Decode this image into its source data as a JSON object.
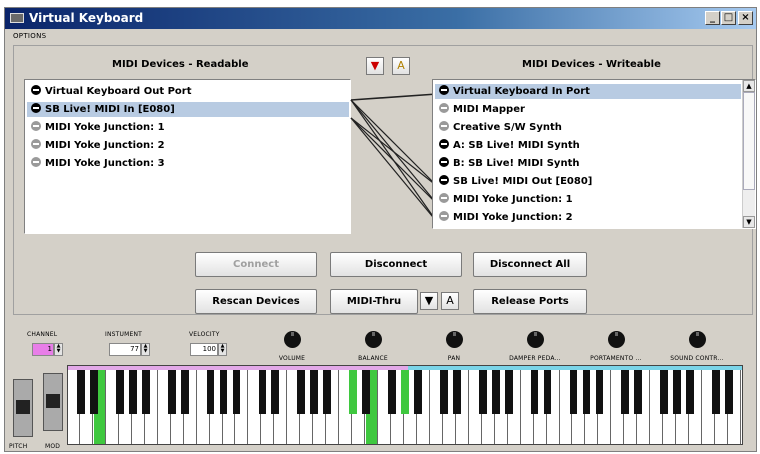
{
  "window": {
    "title": "Virtual Keyboard",
    "min": "_",
    "max": "□",
    "close": "×"
  },
  "menu": {
    "options": "OPTIONS"
  },
  "readable": {
    "header": "MIDI Devices - Readable",
    "items": [
      {
        "label": "Virtual Keyboard Out Port",
        "state": "on",
        "selected": false
      },
      {
        "label": "SB Live! MIDI In [E080]",
        "state": "on",
        "selected": true
      },
      {
        "label": "MIDI Yoke Junction:  1",
        "state": "off",
        "selected": false
      },
      {
        "label": "MIDI Yoke Junction:  2",
        "state": "off",
        "selected": false
      },
      {
        "label": "MIDI Yoke Junction:  3",
        "state": "off",
        "selected": false
      }
    ]
  },
  "writeable": {
    "header": "MIDI Devices - Writeable",
    "items": [
      {
        "label": "Virtual Keyboard In Port",
        "state": "on",
        "selected": true
      },
      {
        "label": "MIDI Mapper",
        "state": "off",
        "selected": false
      },
      {
        "label": "Creative S/W Synth",
        "state": "off",
        "selected": false
      },
      {
        "label": "A: SB Live! MIDI Synth",
        "state": "on",
        "selected": false
      },
      {
        "label": "B: SB Live! MIDI Synth",
        "state": "on",
        "selected": false
      },
      {
        "label": "SB Live! MIDI Out [E080]",
        "state": "on",
        "selected": false
      },
      {
        "label": "MIDI Yoke Junction:  1",
        "state": "off",
        "selected": false
      },
      {
        "label": "MIDI Yoke Junction:  2",
        "state": "off",
        "selected": false
      }
    ]
  },
  "buttons": {
    "connect": "Connect",
    "disconnect": "Disconnect",
    "disconnect_all": "Disconnect All",
    "rescan": "Rescan Devices",
    "midi_thru": "MIDI-Thru",
    "release": "Release Ports"
  },
  "controls": {
    "channel_label": "CHANNEL",
    "channel_value": "1",
    "instrument_label": "INSTUMENT",
    "instrument_value": "77",
    "velocity_label": "VELOCITY",
    "velocity_value": "100",
    "knobs": [
      "VOLUME",
      "BALANCE",
      "PAN",
      "DAMPER PEDA...",
      "PORTAMENTO ...",
      "SOUND CONTR..."
    ],
    "pitch_label": "PITCH",
    "mod_label": "MOD"
  },
  "keyboard": {
    "white_keys": 52,
    "pressed_white": [
      2,
      23
    ],
    "pressed_black": [],
    "pressed_white_partial": [
      21,
      25
    ]
  },
  "colors": {
    "pressed": "#3fc83f",
    "channel_bg": "#e87ee8",
    "pinkbar": "#e2a8e8",
    "cyanbar": "#7ad4e8"
  }
}
